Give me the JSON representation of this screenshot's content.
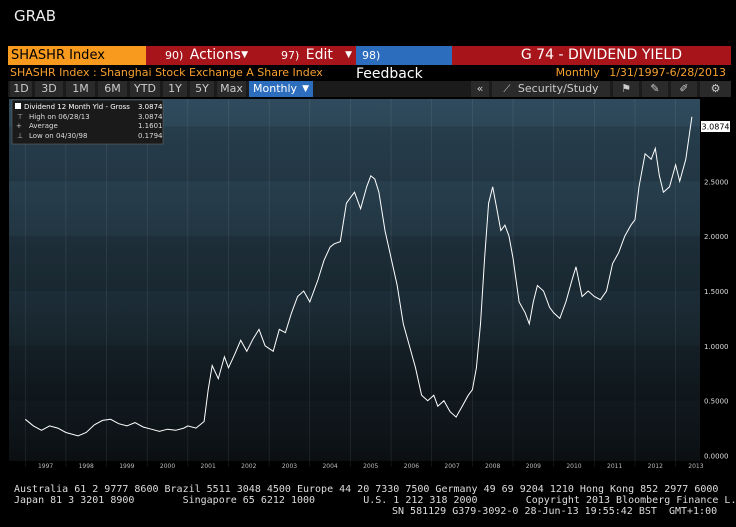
{
  "window": {
    "title": "GRAB"
  },
  "command_bar": {
    "ticker": "SHASHR Index",
    "actions": {
      "num": "90)",
      "label": "Actions"
    },
    "edit": {
      "num": "97)",
      "label": "Edit"
    },
    "feedback": {
      "num": "98)",
      "label": "Feedback"
    },
    "function_title": "G 74 - DIVIDEND YIELD"
  },
  "header": {
    "subtitle": "SHASHR Index : Shanghai Stock Exchange A Share Index",
    "frequency": "Monthly",
    "date_range": "1/31/1997-6/28/2013"
  },
  "toolbar": {
    "ranges": [
      "1D",
      "3D",
      "1M",
      "6M",
      "YTD",
      "1Y",
      "5Y",
      "Max"
    ],
    "frequency_select": "Monthly",
    "collapse": "«",
    "security_study": "Security/Study"
  },
  "legend": {
    "series_name": "Dividend 12 Month Yld - Gross",
    "series_value": "3.0874",
    "high_label": "High on 06/28/13",
    "high_value": "3.0874",
    "avg_label": "Average",
    "avg_value": "1.1601",
    "low_label": "Low on 04/30/98",
    "low_value": "0.1794"
  },
  "chart_data": {
    "type": "line",
    "title": "G 74 - DIVIDEND YIELD",
    "ylim": [
      -0.05,
      3.25
    ],
    "y_ticks": [
      "0.0000",
      "0.5000",
      "1.0000",
      "1.5000",
      "2.0000",
      "2.5000",
      "3.0000"
    ],
    "x_ticks": [
      "1997",
      "1998",
      "1999",
      "2000",
      "2001",
      "2002",
      "2003",
      "2004",
      "2005",
      "2006",
      "2007",
      "2008",
      "2009",
      "2010",
      "2011",
      "2012",
      "2013"
    ],
    "last_value_label": "3.0874",
    "series": [
      {
        "name": "Dividend 12 Month Yld - Gross",
        "color": "#ffffff",
        "points": [
          [
            1997.0,
            0.33
          ],
          [
            1997.2,
            0.27
          ],
          [
            1997.4,
            0.23
          ],
          [
            1997.6,
            0.27
          ],
          [
            1997.8,
            0.25
          ],
          [
            1998.0,
            0.21
          ],
          [
            1998.3,
            0.18
          ],
          [
            1998.5,
            0.21
          ],
          [
            1998.7,
            0.28
          ],
          [
            1998.9,
            0.32
          ],
          [
            1999.1,
            0.33
          ],
          [
            1999.3,
            0.29
          ],
          [
            1999.5,
            0.27
          ],
          [
            1999.7,
            0.3
          ],
          [
            1999.9,
            0.26
          ],
          [
            2000.1,
            0.24
          ],
          [
            2000.3,
            0.22
          ],
          [
            2000.5,
            0.24
          ],
          [
            2000.7,
            0.23
          ],
          [
            2000.9,
            0.25
          ],
          [
            2001.0,
            0.27
          ],
          [
            2001.2,
            0.25
          ],
          [
            2001.4,
            0.31
          ],
          [
            2001.5,
            0.6
          ],
          [
            2001.6,
            0.82
          ],
          [
            2001.75,
            0.7
          ],
          [
            2001.9,
            0.9
          ],
          [
            2002.0,
            0.8
          ],
          [
            2002.15,
            0.92
          ],
          [
            2002.3,
            1.05
          ],
          [
            2002.45,
            0.95
          ],
          [
            2002.6,
            1.06
          ],
          [
            2002.75,
            1.15
          ],
          [
            2002.9,
            1.0
          ],
          [
            2003.1,
            0.95
          ],
          [
            2003.25,
            1.15
          ],
          [
            2003.4,
            1.12
          ],
          [
            2003.55,
            1.3
          ],
          [
            2003.7,
            1.45
          ],
          [
            2003.85,
            1.5
          ],
          [
            2004.0,
            1.4
          ],
          [
            2004.2,
            1.6
          ],
          [
            2004.35,
            1.78
          ],
          [
            2004.5,
            1.9
          ],
          [
            2004.6,
            1.93
          ],
          [
            2004.75,
            1.95
          ],
          [
            2004.9,
            2.3
          ],
          [
            2005.0,
            2.35
          ],
          [
            2005.1,
            2.4
          ],
          [
            2005.25,
            2.25
          ],
          [
            2005.4,
            2.45
          ],
          [
            2005.5,
            2.55
          ],
          [
            2005.6,
            2.52
          ],
          [
            2005.7,
            2.4
          ],
          [
            2005.85,
            2.05
          ],
          [
            2006.0,
            1.8
          ],
          [
            2006.15,
            1.55
          ],
          [
            2006.3,
            1.2
          ],
          [
            2006.45,
            1.0
          ],
          [
            2006.6,
            0.8
          ],
          [
            2006.75,
            0.55
          ],
          [
            2006.9,
            0.5
          ],
          [
            2007.05,
            0.55
          ],
          [
            2007.15,
            0.45
          ],
          [
            2007.3,
            0.5
          ],
          [
            2007.45,
            0.4
          ],
          [
            2007.6,
            0.35
          ],
          [
            2007.75,
            0.45
          ],
          [
            2007.9,
            0.55
          ],
          [
            2008.0,
            0.6
          ],
          [
            2008.1,
            0.8
          ],
          [
            2008.2,
            1.2
          ],
          [
            2008.3,
            1.8
          ],
          [
            2008.4,
            2.3
          ],
          [
            2008.5,
            2.45
          ],
          [
            2008.6,
            2.25
          ],
          [
            2008.7,
            2.05
          ],
          [
            2008.8,
            2.1
          ],
          [
            2008.9,
            2.0
          ],
          [
            2009.0,
            1.8
          ],
          [
            2009.15,
            1.4
          ],
          [
            2009.3,
            1.3
          ],
          [
            2009.4,
            1.2
          ],
          [
            2009.5,
            1.4
          ],
          [
            2009.6,
            1.55
          ],
          [
            2009.75,
            1.5
          ],
          [
            2009.9,
            1.35
          ],
          [
            2010.0,
            1.3
          ],
          [
            2010.15,
            1.25
          ],
          [
            2010.3,
            1.4
          ],
          [
            2010.45,
            1.6
          ],
          [
            2010.55,
            1.72
          ],
          [
            2010.7,
            1.45
          ],
          [
            2010.85,
            1.5
          ],
          [
            2011.0,
            1.45
          ],
          [
            2011.15,
            1.42
          ],
          [
            2011.3,
            1.5
          ],
          [
            2011.45,
            1.75
          ],
          [
            2011.6,
            1.85
          ],
          [
            2011.75,
            2.0
          ],
          [
            2011.9,
            2.1
          ],
          [
            2012.0,
            2.15
          ],
          [
            2012.1,
            2.45
          ],
          [
            2012.25,
            2.75
          ],
          [
            2012.4,
            2.7
          ],
          [
            2012.5,
            2.8
          ],
          [
            2012.6,
            2.55
          ],
          [
            2012.7,
            2.4
          ],
          [
            2012.85,
            2.45
          ],
          [
            2013.0,
            2.65
          ],
          [
            2013.1,
            2.5
          ],
          [
            2013.25,
            2.7
          ],
          [
            2013.4,
            3.0874
          ]
        ]
      }
    ]
  },
  "footer": {
    "line1": "Australia 61 2 9777 8600 Brazil 5511 3048 4500 Europe 44 20 7330 7500 Germany 49 69 9204 1210 Hong Kong 852 2977 6000",
    "line2": "Japan 81 3 3201 8900        Singapore 65 6212 1000        U.S. 1 212 318 2000        Copyright 2013 Bloomberg Finance L.P.",
    "line3": "SN 581129 G379-3092-0 28-Jun-13 19:55:42 BST  GMT+1:00"
  }
}
